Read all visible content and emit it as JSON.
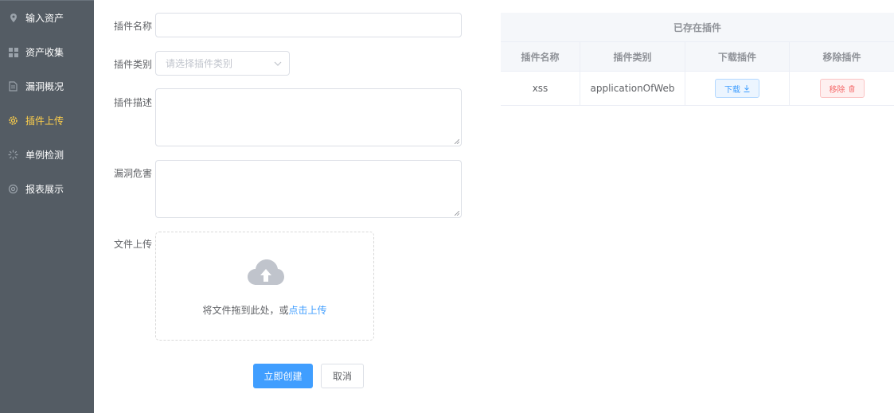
{
  "sidebar": {
    "items": [
      {
        "label": "输入资产",
        "icon": "location-icon"
      },
      {
        "label": "资产收集",
        "icon": "grid-icon"
      },
      {
        "label": "漏洞概况",
        "icon": "document-icon"
      },
      {
        "label": "插件上传",
        "icon": "gear-icon",
        "active": true
      },
      {
        "label": "单例检测",
        "icon": "loading-icon"
      },
      {
        "label": "报表展示",
        "icon": "settings-icon"
      }
    ]
  },
  "form": {
    "name_label": "插件名称",
    "name_value": "",
    "type_label": "插件类别",
    "type_placeholder": "请选择插件类别",
    "desc_label": "插件描述",
    "desc_value": "",
    "harm_label": "漏洞危害",
    "harm_value": "",
    "upload_label": "文件上传",
    "upload_text": "将文件拖到此处，或",
    "upload_link": "点击上传",
    "submit_label": "立即创建",
    "cancel_label": "取消"
  },
  "table": {
    "title": "已存在插件",
    "headers": [
      "插件名称",
      "插件类别",
      "下载插件",
      "移除插件"
    ],
    "rows": [
      {
        "name": "xss",
        "type": "applicationOfWeb",
        "download_label": "下载",
        "remove_label": "移除"
      }
    ]
  },
  "colors": {
    "sidebar_bg": "#545c64",
    "sidebar_active": "#ffd04b",
    "primary": "#409eff",
    "danger": "#f56c6c"
  }
}
